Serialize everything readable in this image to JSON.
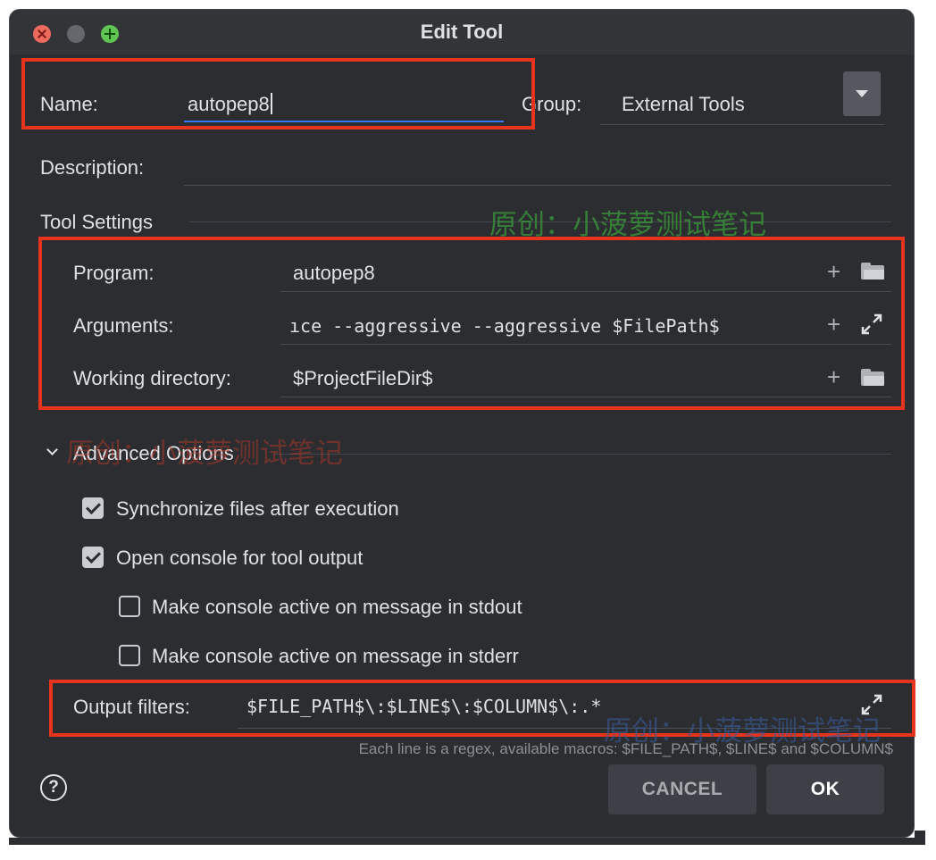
{
  "window": {
    "title": "Edit Tool"
  },
  "form": {
    "name_label": "Name:",
    "name_value": "autopep8",
    "group_label": "Group:",
    "group_value": "External Tools",
    "description_label": "Description:",
    "description_value": ""
  },
  "tool_settings": {
    "header": "Tool Settings",
    "program_label": "Program:",
    "program_value": "autopep8",
    "arguments_label": "Arguments:",
    "arguments_value": "ıce --aggressive --aggressive $FilePath$",
    "working_dir_label": "Working directory:",
    "working_dir_value": "$ProjectFileDir$"
  },
  "advanced": {
    "header": "Advanced Options",
    "sync_files": {
      "label": "Synchronize files after execution",
      "checked": true
    },
    "open_console": {
      "label": "Open console for tool output",
      "checked": true
    },
    "console_stdout": {
      "label": "Make console active on message in stdout",
      "checked": false
    },
    "console_stderr": {
      "label": "Make console active on message in stderr",
      "checked": false
    },
    "output_filters_label": "Output filters:",
    "output_filters_value": "$FILE_PATH$\\:$LINE$\\:$COLUMN$\\:.*",
    "output_filters_hint": "Each line is a regex, available macros: $FILE_PATH$, $LINE$ and $COLUMN$"
  },
  "buttons": {
    "help": "?",
    "cancel": "CANCEL",
    "ok": "OK"
  },
  "watermarks": [
    "原创：小菠萝测试笔记",
    "原创：小菠萝测试笔记",
    "原创：小菠萝测试笔记"
  ],
  "colors": {
    "background": "#2b2d30",
    "accent": "#3574f0",
    "highlight_box": "#e8331d",
    "watermark_green": "#3a9a3a",
    "watermark_red": "#c0392b",
    "watermark_blue": "#3a5a9a"
  }
}
